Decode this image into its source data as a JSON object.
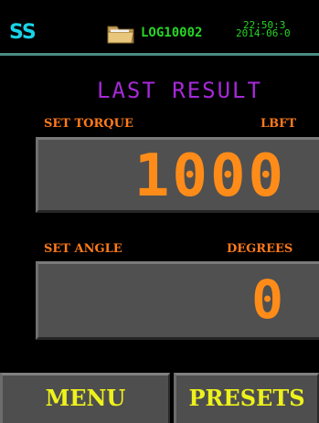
{
  "top_bar": {
    "logo": "SS",
    "folder_icon": "folder-icon",
    "log_file": "LOG10002",
    "time": "22:50:3",
    "date": "2014-06-0"
  },
  "header": {
    "title": "LAST RESULT"
  },
  "torque": {
    "label": "SET TORQUE",
    "unit": "LBFT",
    "value": "1000"
  },
  "angle": {
    "label": "SET ANGLE",
    "unit": "DEGREES",
    "value": "0"
  },
  "buttons": {
    "menu_label": "MENU",
    "presets_label": "PRESETS"
  },
  "colors": {
    "background": "#000000",
    "logo": "#19d3e6",
    "status_text": "#27d627",
    "title": "#a629d8",
    "label": "#ff7a1a",
    "value": "#ff8c19",
    "button_text": "#eef21c",
    "panel": "#505050",
    "divider": "#4a8c84"
  }
}
